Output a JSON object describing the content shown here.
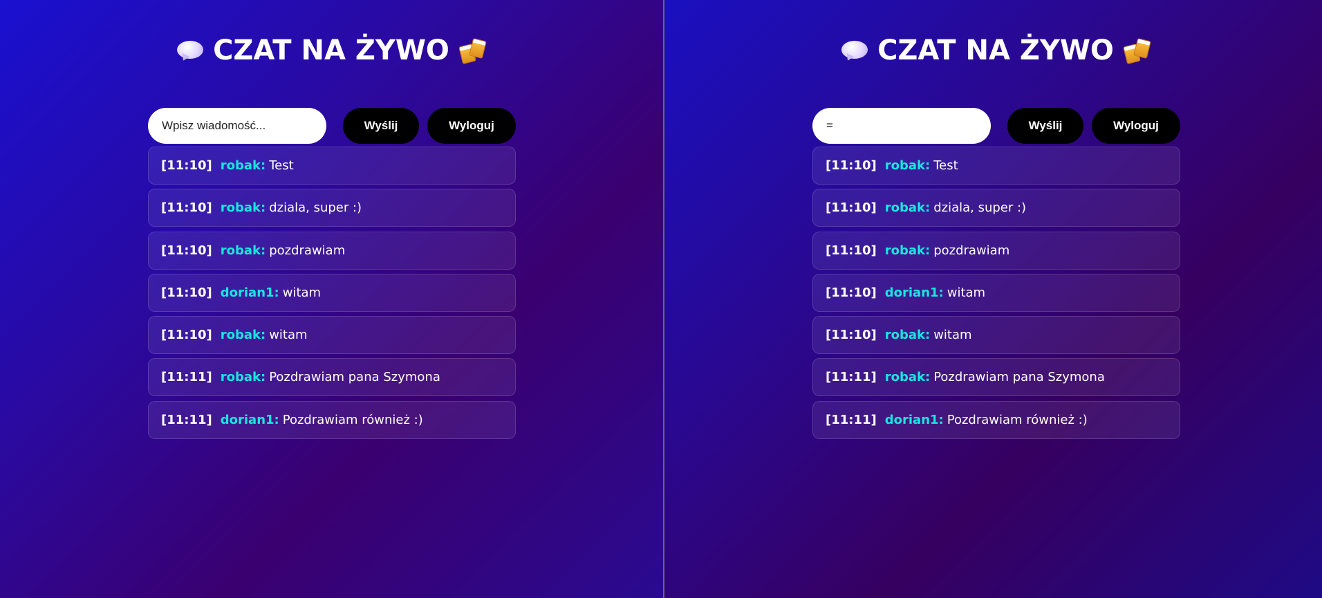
{
  "colors": {
    "username": "#19e6de",
    "button_bg": "#000000",
    "button_text": "#ffffff",
    "background_start": "#1a10d0",
    "background_end": "#3a0070"
  },
  "panes": [
    {
      "title": "CZAT NA ŻYWO",
      "title_icons": [
        "speech-bubble-icon",
        "beer-mugs-icon"
      ],
      "input": {
        "value": "",
        "placeholder": "Wpisz wiadomość..."
      },
      "send_label": "Wyślij",
      "logout_label": "Wyloguj",
      "messages": [
        {
          "time": "[11:10]",
          "user": "robak:",
          "text": "Test"
        },
        {
          "time": "[11:10]",
          "user": "robak:",
          "text": "dziala, super :)"
        },
        {
          "time": "[11:10]",
          "user": "robak:",
          "text": "pozdrawiam"
        },
        {
          "time": "[11:10]",
          "user": "dorian1:",
          "text": "witam"
        },
        {
          "time": "[11:10]",
          "user": "robak:",
          "text": "witam"
        },
        {
          "time": "[11:11]",
          "user": "robak:",
          "text": "Pozdrawiam pana Szymona"
        },
        {
          "time": "[11:11]",
          "user": "dorian1:",
          "text": "Pozdrawiam również :)"
        }
      ]
    },
    {
      "title": "CZAT NA ŻYWO",
      "title_icons": [
        "speech-bubble-icon",
        "beer-mugs-icon"
      ],
      "input": {
        "value": "=",
        "placeholder": "Wpisz wiadomość..."
      },
      "send_label": "Wyślij",
      "logout_label": "Wyloguj",
      "messages": [
        {
          "time": "[11:10]",
          "user": "robak:",
          "text": "Test"
        },
        {
          "time": "[11:10]",
          "user": "robak:",
          "text": "dziala, super :)"
        },
        {
          "time": "[11:10]",
          "user": "robak:",
          "text": "pozdrawiam"
        },
        {
          "time": "[11:10]",
          "user": "dorian1:",
          "text": "witam"
        },
        {
          "time": "[11:10]",
          "user": "robak:",
          "text": "witam"
        },
        {
          "time": "[11:11]",
          "user": "robak:",
          "text": "Pozdrawiam pana Szymona"
        },
        {
          "time": "[11:11]",
          "user": "dorian1:",
          "text": "Pozdrawiam również :)"
        }
      ]
    }
  ]
}
